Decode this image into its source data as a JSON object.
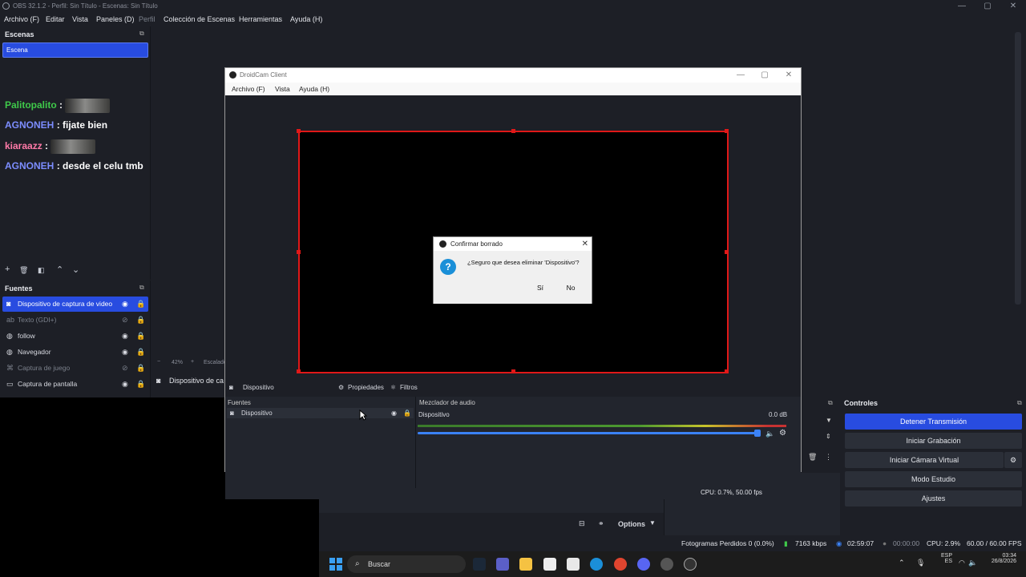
{
  "window": {
    "title": "OBS 32.1.2 - Perfil: Sin Título - Escenas: Sin Título"
  },
  "menu": [
    "Archivo (F)",
    "Editar",
    "Vista",
    "Paneles (D)",
    "Perfil",
    "Colección de Escenas",
    "Herramientas",
    "Ayuda (H)"
  ],
  "scenes": {
    "title": "Escenas",
    "items": [
      "Escena"
    ]
  },
  "chat": [
    {
      "user": "Palitopalito",
      "text": ":",
      "color": "#3fc94a"
    },
    {
      "user": "AGNONEH",
      "text": ": fijate bien",
      "color": "#7c8dff"
    },
    {
      "user": "kiaraazz",
      "text": ":",
      "color": "#ff7aa8"
    },
    {
      "user": "AGNONEH",
      "text": ": desde el celu tmb",
      "color": "#7c8dff"
    }
  ],
  "sources": {
    "title": "Fuentes",
    "items": [
      {
        "label": "Dispositivo de captura de video",
        "visible": true
      },
      {
        "label": "Texto (GDI+)",
        "visible": false
      },
      {
        "label": "follow",
        "visible": true
      },
      {
        "label": "Navegador",
        "visible": true
      },
      {
        "label": "Captura de juego",
        "visible": false
      },
      {
        "label": "Captura de pantalla",
        "visible": true
      }
    ]
  },
  "preview": {
    "zoom": "42%",
    "scale_label": "Escalado",
    "source_label": "Dispositivo de ca"
  },
  "droidcam": {
    "title": "DroidCam Client",
    "menu": [
      "Archivo (F)",
      "Vista",
      "Ayuda (H)"
    ],
    "srcbar": {
      "source": "Dispositivo",
      "props": "Propiedades",
      "filters": "Filtros"
    },
    "lower": {
      "sources_title": "Fuentes",
      "source_item": "Dispositivo",
      "mixer_title": "Mezclador de audio",
      "mixer_item": "Dispositivo",
      "db": "0.0 dB"
    },
    "status": "CPU: 0.7%, 50.00 fps"
  },
  "dialog": {
    "title": "Confirmar borrado",
    "message": "¿Seguro que desea eliminar 'Dispositivo'?",
    "yes": "Sí",
    "no": "No"
  },
  "controls": {
    "title": "Controles",
    "buttons": [
      "Detener Transmisión",
      "Iniciar Grabación",
      "Iniciar Cámara Virtual",
      "Modo Estudio",
      "Ajustes"
    ]
  },
  "toolbar2": {
    "options": "Options"
  },
  "status": {
    "dropped": "Fotogramas Perdidos 0 (0.0%)",
    "bitrate": "7163 kbps",
    "stream_time": "02:59:07",
    "rec_time": "00:00:00",
    "cpu": "CPU: 2.9%",
    "fps": "60.00 / 60.00 FPS"
  },
  "taskbar": {
    "search": "Buscar",
    "lang": "ESP",
    "lang2": "ES",
    "time": "03:34",
    "date": "26/8/2026"
  }
}
